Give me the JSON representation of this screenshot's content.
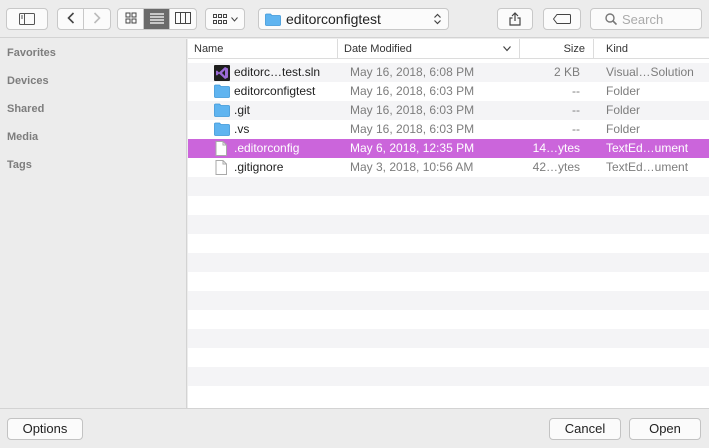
{
  "toolbar": {
    "path_label": "editorconfigtest",
    "search_placeholder": "Search",
    "active_view": "list"
  },
  "sidebar": {
    "sections": [
      "Favorites",
      "Devices",
      "Shared",
      "Media",
      "Tags"
    ]
  },
  "columns": {
    "name": "Name",
    "date": "Date Modified",
    "size": "Size",
    "kind": "Kind"
  },
  "files": [
    {
      "name": "editorc…test.sln",
      "date": "May 16, 2018, 6:08 PM",
      "size": "2 KB",
      "kind": "Visual…Solution",
      "icon": "vs-solution-icon",
      "selected": false
    },
    {
      "name": "editorconfigtest",
      "date": "May 16, 2018, 6:03 PM",
      "size": "--",
      "kind": "Folder",
      "icon": "folder-icon",
      "selected": false
    },
    {
      "name": ".git",
      "date": "May 16, 2018, 6:03 PM",
      "size": "--",
      "kind": "Folder",
      "icon": "folder-icon",
      "selected": false
    },
    {
      "name": ".vs",
      "date": "May 16, 2018, 6:03 PM",
      "size": "--",
      "kind": "Folder",
      "icon": "folder-icon",
      "selected": false
    },
    {
      "name": ".editorconfig",
      "date": "May 6, 2018, 12:35 PM",
      "size": "14…ytes",
      "kind": "TextEd…ument",
      "icon": "document-icon",
      "selected": true
    },
    {
      "name": ".gitignore",
      "date": "May 3, 2018, 10:56 AM",
      "size": "42…ytes",
      "kind": "TextEd…ument",
      "icon": "document-icon",
      "selected": false
    }
  ],
  "footer": {
    "options_label": "Options",
    "cancel_label": "Cancel",
    "open_label": "Open"
  },
  "colors": {
    "selection": "#cb65db",
    "folder": "#5fb4f0"
  }
}
